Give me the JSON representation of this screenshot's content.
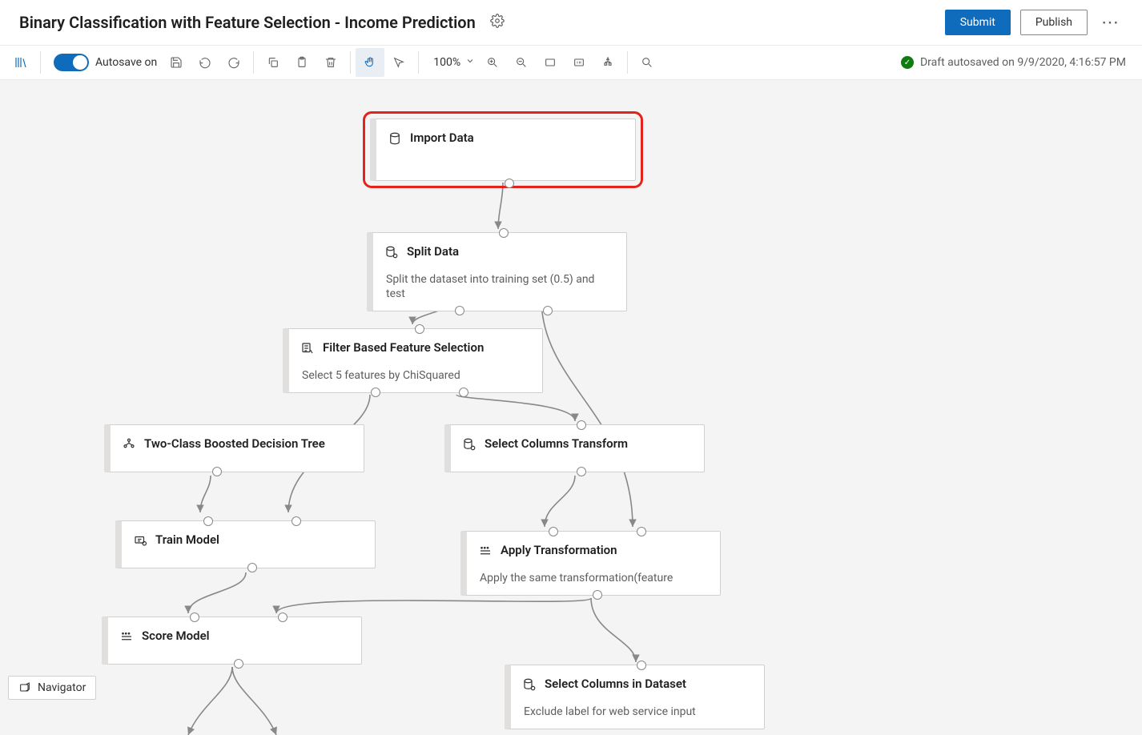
{
  "header": {
    "title": "Binary Classification with Feature Selection - Income Prediction",
    "submit": "Submit",
    "publish": "Publish"
  },
  "toolbar": {
    "autosave_label": "Autosave on",
    "zoom": "100%"
  },
  "status": {
    "text": "Draft autosaved on 9/9/2020, 4:16:57 PM"
  },
  "navigator": {
    "label": "Navigator"
  },
  "nodes": {
    "import_data": {
      "title": "Import Data"
    },
    "split_data": {
      "title": "Split Data",
      "sub": "Split the dataset into training set (0.5) and test"
    },
    "filter_fs": {
      "title": "Filter Based Feature Selection",
      "sub": "Select 5 features by ChiSquared"
    },
    "bdt": {
      "title": "Two-Class Boosted Decision Tree"
    },
    "select_cols_transform": {
      "title": "Select Columns Transform"
    },
    "train_model": {
      "title": "Train Model"
    },
    "apply_transform": {
      "title": "Apply Transformation",
      "sub": "Apply the same transformation(feature"
    },
    "score_model": {
      "title": "Score Model"
    },
    "select_cols_dataset": {
      "title": "Select Columns in Dataset",
      "sub": "Exclude label for web service input"
    }
  }
}
